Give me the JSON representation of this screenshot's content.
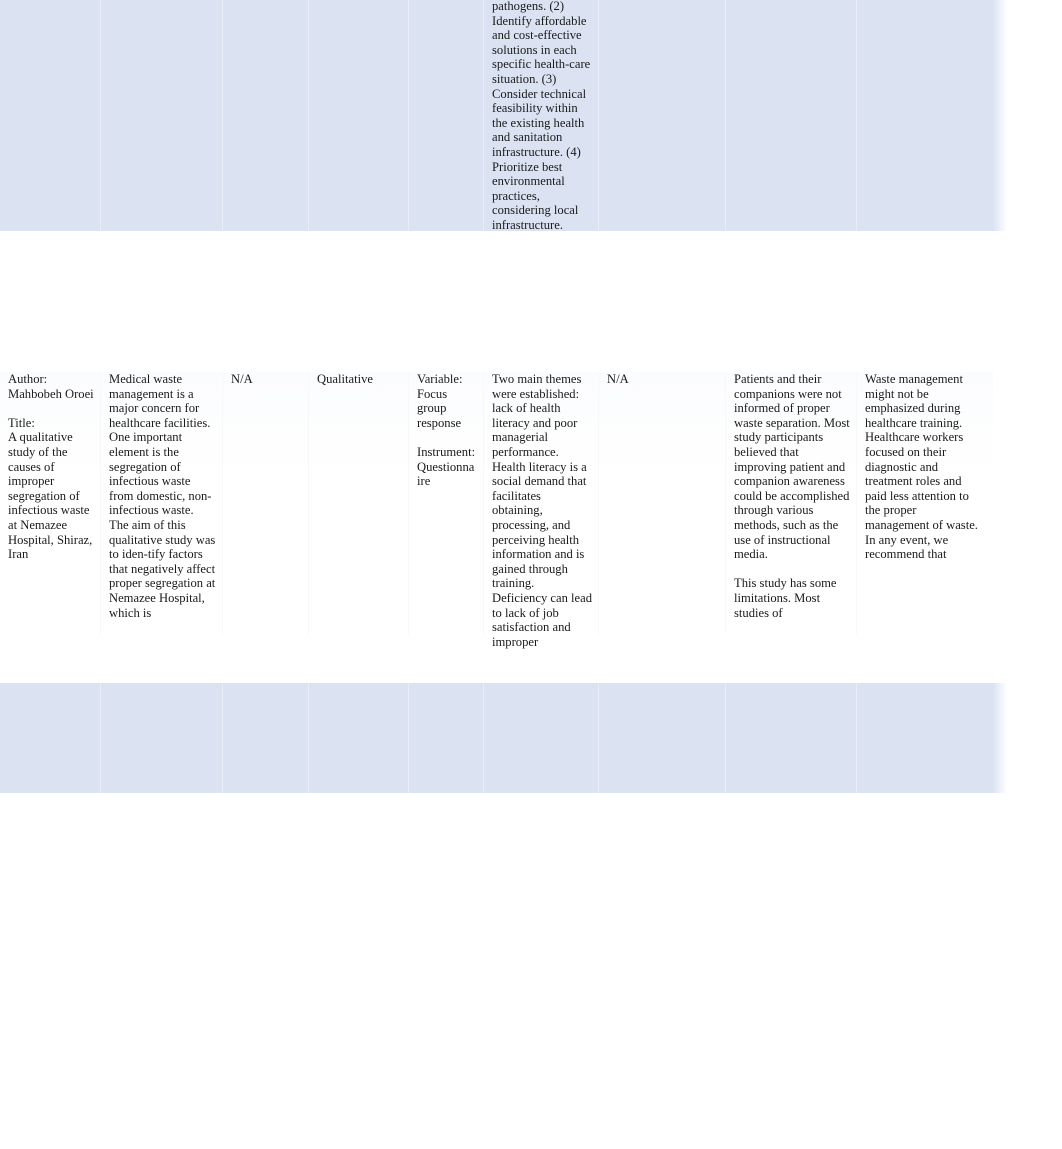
{
  "document": {
    "type": "literature-review-matrix-table",
    "page_background": "#ffffff",
    "shaded_row_color": "#dbe3f3",
    "text_color": "#1a1a1a"
  },
  "rows": [
    {
      "id": "row-previous-study-tail",
      "shaded": true,
      "cells": {
        "c1": "",
        "c2": "",
        "c3": "",
        "c4": "",
        "c5": "",
        "c6": "pathogens. (2) Identify affordable and cost-effective solutions in each specific health-care situation. (3) Consider technical feasibility within the existing health and sanitation infrastructure. (4) Prioritize best environmental practices, considering local infrastructure.",
        "c7": "",
        "c8": "",
        "c9": ""
      }
    },
    {
      "id": "row-oroei-study",
      "shaded": false,
      "cells": {
        "c1_author_label": "Author:",
        "c1_author_name": "Mahbobeh Oroei",
        "c1_title_label": "Title:",
        "c1_title_text": "A qualitative study of the causes of improper segregation of infectious waste at Nemazee Hospital, Shiraz, Iran",
        "c2": "Medical waste management is a major concern for healthcare facilities. One important element is the segregation of infectious waste from domestic, non-infectious waste. The aim of this qualitative study was to iden-tify factors that negatively affect proper segregation at Nemazee Hospital, which is",
        "c3": "N/A",
        "c4": "Qualitative",
        "c5_variable_label": "Variable:",
        "c5_variable_text": "Focus group response",
        "c5_instrument_label": "Instrument:",
        "c5_instrument_text": "Questionnaire",
        "c6": "Two main themes were established: lack of health literacy and poor managerial performance. Health literacy is a social demand that facilitates obtaining, processing, and perceiving health information and is gained through training. Deficiency can lead to lack of job satisfaction and improper",
        "c7": "N/A",
        "c8_para1": "Patients and their companions were not informed of proper waste separation. Most study participants believed that improving patient and companion awareness could be accomplished through various methods, such as the use of instructional media.",
        "c8_para2": "This study has some limitations. Most studies of",
        "c9": "Waste management might not be emphasized during healthcare training. Healthcare workers focused on their diagnostic and treatment roles and paid less attention to the proper management of waste. In any event, we recommend that"
      }
    },
    {
      "id": "row-next-study-blank",
      "shaded": true,
      "cells": {
        "c1": "",
        "c2": "",
        "c3": "",
        "c4": "",
        "c5": "",
        "c6": "",
        "c7": "",
        "c8": "",
        "c9": ""
      }
    }
  ]
}
